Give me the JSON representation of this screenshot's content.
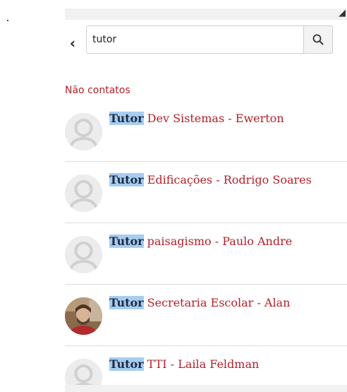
{
  "search": {
    "value": "tutor",
    "placeholder": ""
  },
  "section_label": "Não contatos",
  "results": [
    {
      "highlight": "Tutor",
      "rest": " Dev Sistemas - Ewerton",
      "avatar": "default-avatar"
    },
    {
      "highlight": "Tutor",
      "rest": " Edificações - Rodrigo Soares",
      "avatar": "default-avatar"
    },
    {
      "highlight": "Tutor",
      "rest": " paisagismo - Paulo Andre",
      "avatar": "default-avatar"
    },
    {
      "highlight": "Tutor",
      "rest": " Secretaria Escolar - Alan",
      "avatar": "photo-avatar"
    },
    {
      "highlight": "Tutor",
      "rest": " TTI - Laila Feldman",
      "avatar": "default-avatar"
    }
  ],
  "icons": {
    "back": "chevron-left-icon",
    "search": "search-icon",
    "corner": "expand-icon"
  },
  "colors": {
    "link_red": "#b4202a",
    "highlight_blue": "#a7cdf0",
    "border_gray": "#cfcfcf"
  }
}
